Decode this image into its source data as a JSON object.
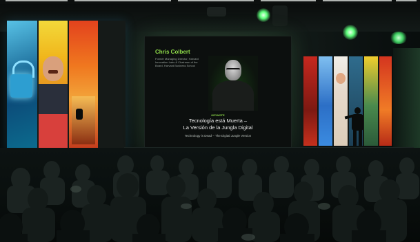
{
  "scene": {
    "description_type": "conference-keynote",
    "colors": {
      "accent_green": "#8fdc4a",
      "screen_text": "#f0f0f0",
      "stage_light": "#6dff8c"
    }
  },
  "center_slide": {
    "speaker_name": "Chris Colbert",
    "speaker_role": "Former Managing Director, Harvard Innovation Labs & Chairman of the Board, Harvard Business School",
    "session_label": "KEYNOTE",
    "title_line1": "Tecnología está Muerta –",
    "title_line2": "La Versión de la Jungla Digital",
    "subtitle": "Technology is Dead – The Digital Jungle Version"
  }
}
